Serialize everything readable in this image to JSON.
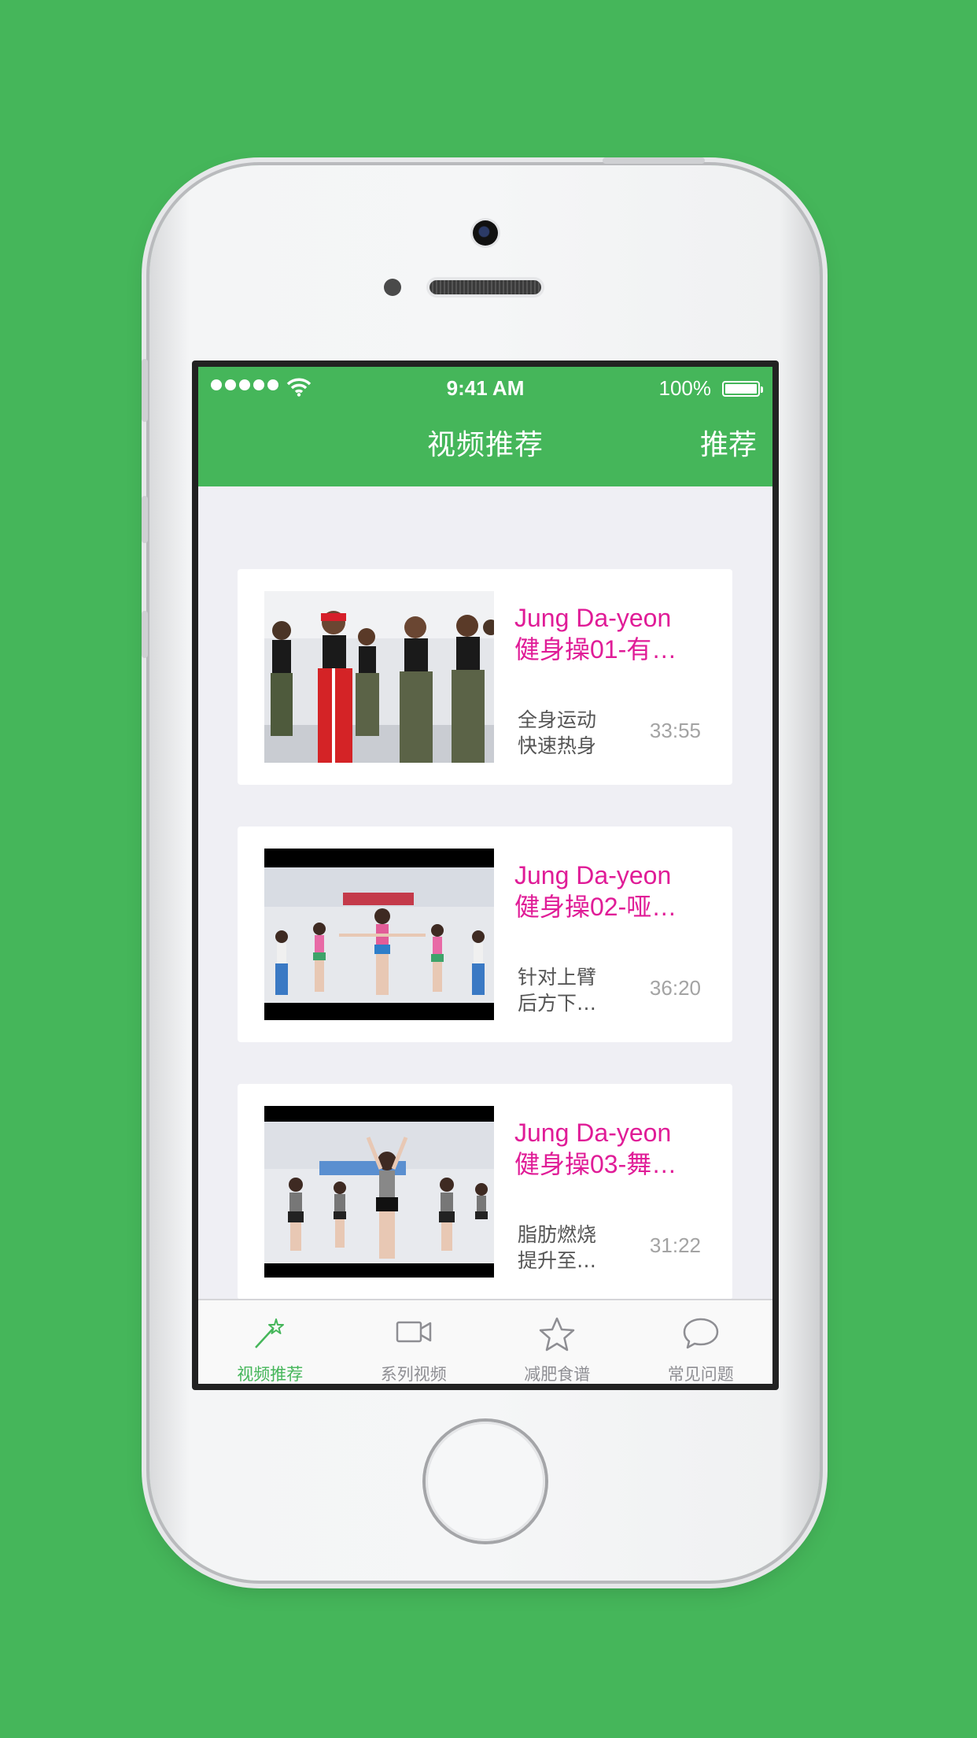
{
  "colors": {
    "brand_green": "#45b65a",
    "title_pink": "#e01c97",
    "background": "#efeff4",
    "tab_inactive": "#8e8e93"
  },
  "status_bar": {
    "time": "9:41 AM",
    "battery": "100%",
    "signal_dots": 5
  },
  "nav": {
    "title": "视频推荐",
    "right_button": "推荐"
  },
  "videos": [
    {
      "title_line1": "Jung Da-yeon",
      "title_line2": "健身操01-有…",
      "desc_line1": "全身运动",
      "desc_line2": "快速热身",
      "duration": "33:55"
    },
    {
      "title_line1": "Jung Da-yeon",
      "title_line2": "健身操02-哑…",
      "desc_line1": "针对上臂",
      "desc_line2": "后方下…",
      "duration": "36:20"
    },
    {
      "title_line1": "Jung Da-yeon",
      "title_line2": "健身操03-舞…",
      "desc_line1": "脂肪燃烧",
      "desc_line2": "提升至…",
      "duration": "31:22"
    }
  ],
  "tabs": [
    {
      "label": "视频推荐",
      "icon": "magic-wand-icon",
      "active": true
    },
    {
      "label": "系列视频",
      "icon": "video-camera-icon",
      "active": false
    },
    {
      "label": "减肥食谱",
      "icon": "star-icon",
      "active": false
    },
    {
      "label": "常见问题",
      "icon": "chat-bubble-icon",
      "active": false
    }
  ]
}
